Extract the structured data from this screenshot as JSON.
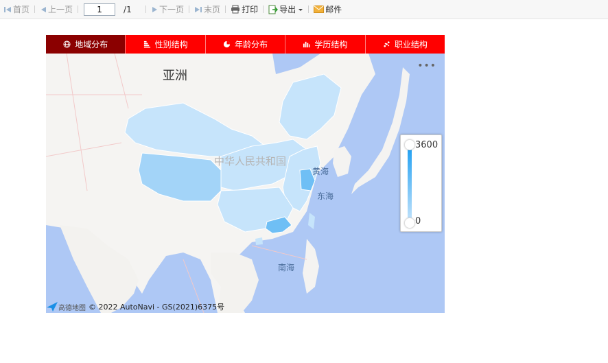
{
  "toolbar": {
    "first": "首页",
    "prev": "上一页",
    "page_value": "1",
    "page_total": "/1",
    "next": "下一页",
    "last": "末页",
    "print": "打印",
    "export": "导出",
    "mail": "邮件"
  },
  "tabs": [
    {
      "label": "地域分布",
      "icon": "globe-icon",
      "selected": true
    },
    {
      "label": "性别结构",
      "icon": "bar-list-icon",
      "selected": false
    },
    {
      "label": "年龄分布",
      "icon": "pie-icon",
      "selected": false
    },
    {
      "label": "学历结构",
      "icon": "column-chart-icon",
      "selected": false
    },
    {
      "label": "职业结构",
      "icon": "scatter-icon",
      "selected": false
    }
  ],
  "map": {
    "continent_label": "亚洲",
    "country_label": "中华人民共和国",
    "sea_labels": [
      "黄海",
      "东海",
      "南海"
    ],
    "more_menu": "•••",
    "attribution_brand": "高德地图",
    "attribution": "© 2022 AutoNavi - GS(2021)6375号",
    "colors": {
      "sea": "#aec8f5",
      "land": "#f5f4f2",
      "province_low": "#c6e4fb",
      "province_high": "#6fbff5"
    }
  },
  "legend": {
    "max": "3600",
    "min": "0",
    "color_high": "#1e9ff2",
    "color_low": "#c6e4fb"
  }
}
